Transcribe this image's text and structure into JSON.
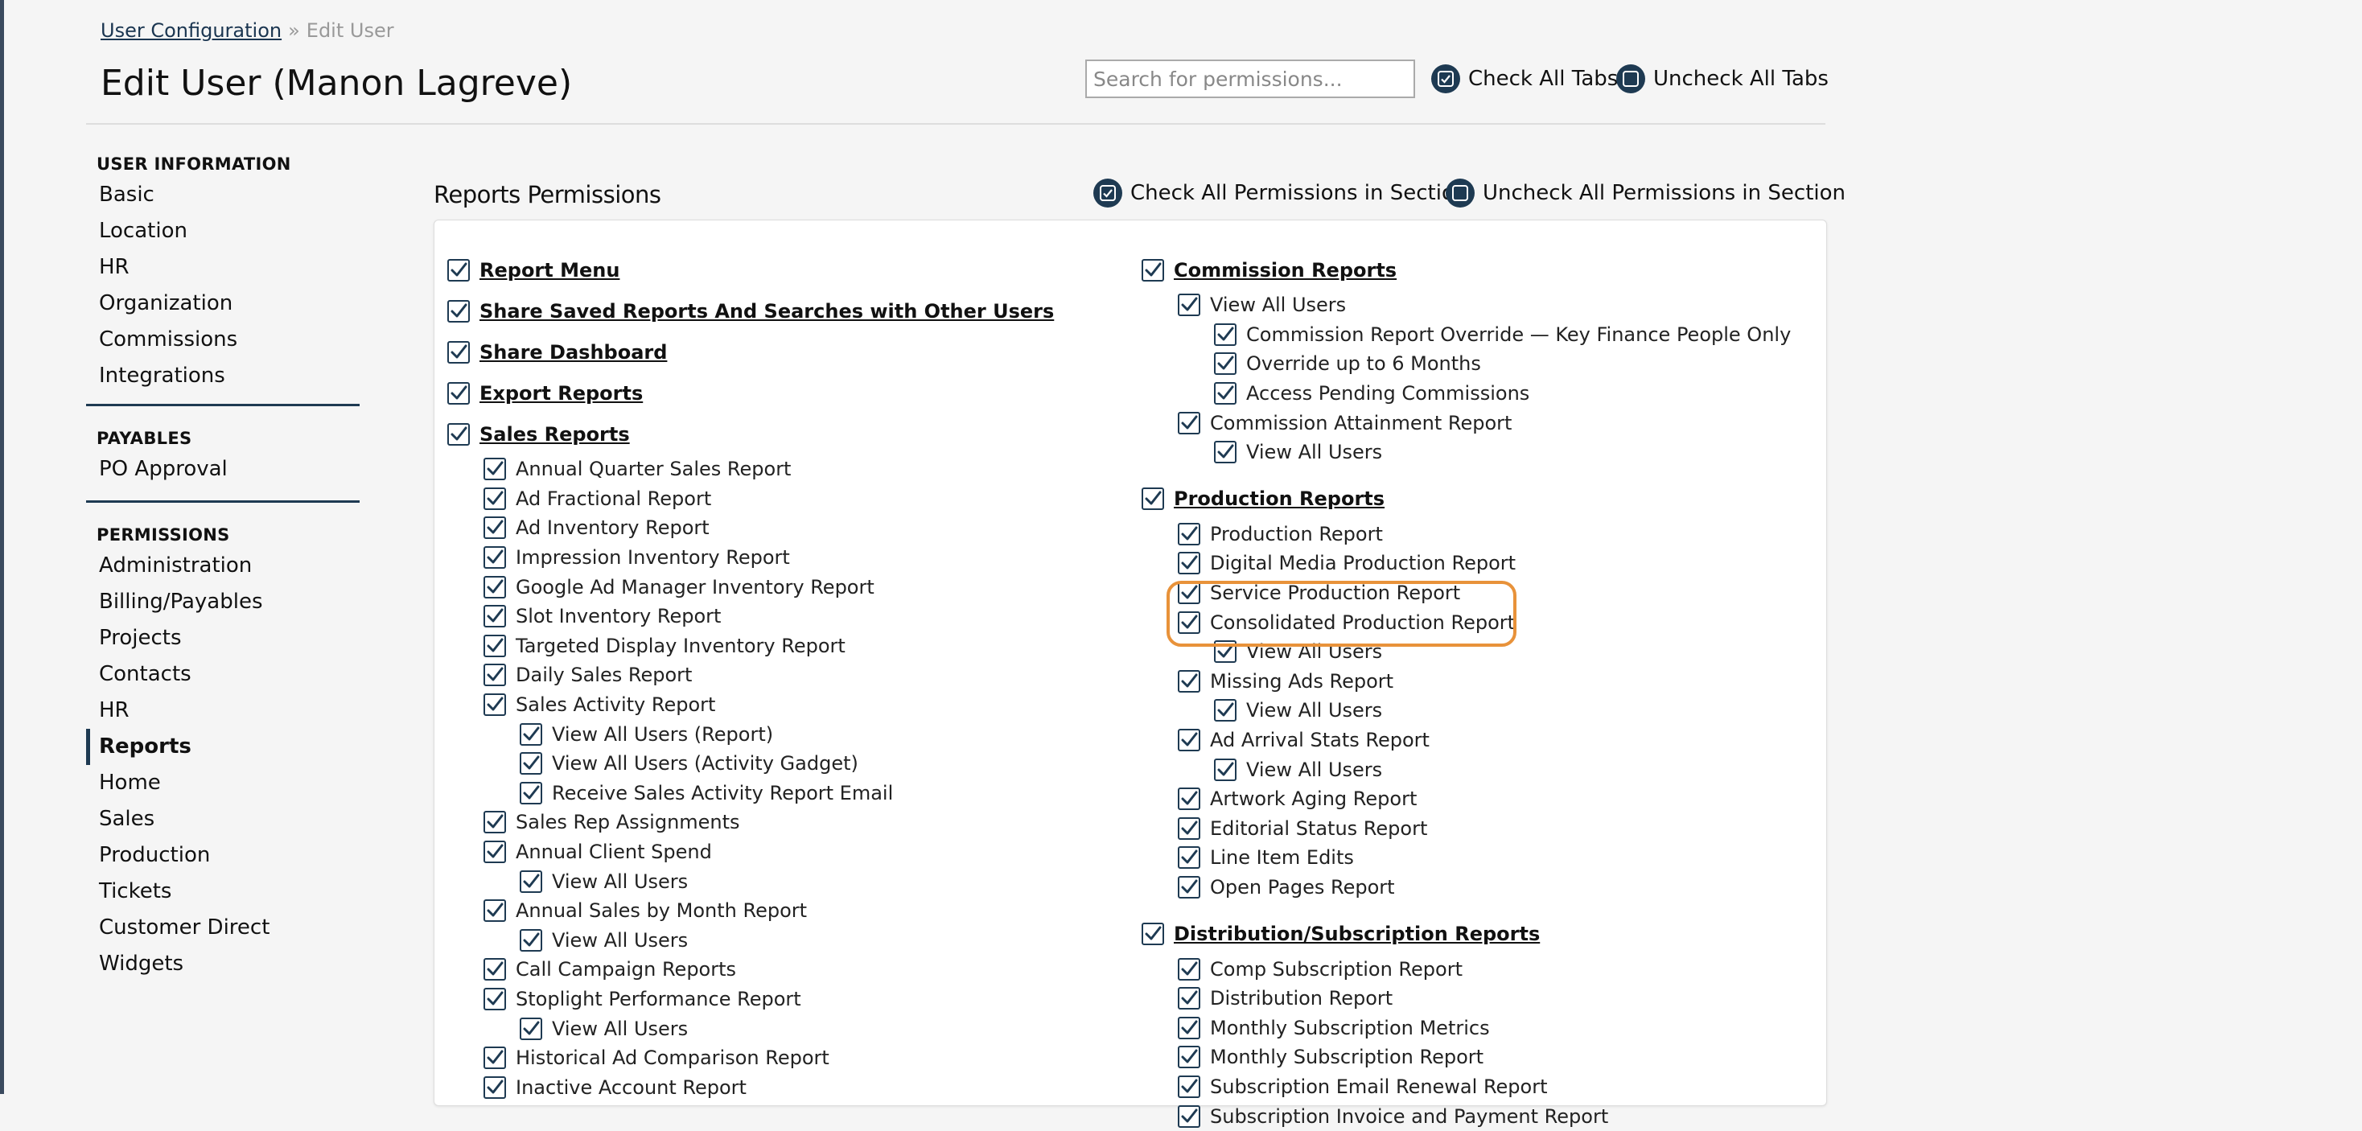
{
  "breadcrumb": {
    "link": "User Configuration",
    "separator": "»",
    "current": "Edit User"
  },
  "page_title": "Edit User (Manon Lagreve)",
  "search": {
    "placeholder": "Search for permissions...",
    "value": ""
  },
  "tab_actions": {
    "check_all": "Check All Tabs",
    "uncheck_all": "Uncheck All Tabs"
  },
  "sidebar": {
    "sections": [
      {
        "heading": "USER INFORMATION",
        "items": [
          "Basic",
          "Location",
          "HR",
          "Organization",
          "Commissions",
          "Integrations"
        ]
      },
      {
        "heading": "PAYABLES",
        "items": [
          "PO Approval"
        ]
      },
      {
        "heading": "PERMISSIONS",
        "items": [
          "Administration",
          "Billing/Payables",
          "Projects",
          "Contacts",
          "HR",
          "Reports",
          "Home",
          "Sales",
          "Production",
          "Tickets",
          "Customer Direct",
          "Widgets"
        ]
      }
    ],
    "active": "Reports"
  },
  "section": {
    "title": "Reports Permissions",
    "check_all": "Check All Permissions in Section",
    "uncheck_all": "Uncheck All Permissions in Section"
  },
  "colors": {
    "accent": "#1e3a52",
    "highlight": "#e8923a"
  },
  "permissions": {
    "left": [
      {
        "label": "Report Menu",
        "level": 0,
        "checked": true
      },
      {
        "label": "Share Saved Reports And Searches with Other Users",
        "level": 0,
        "checked": true
      },
      {
        "label": "Share Dashboard",
        "level": 0,
        "checked": true
      },
      {
        "label": "Export Reports",
        "level": 0,
        "checked": true
      },
      {
        "label": "Sales Reports",
        "level": 0,
        "checked": true
      },
      {
        "label": "Annual Quarter Sales Report",
        "level": 1,
        "checked": true
      },
      {
        "label": "Ad Fractional Report",
        "level": 1,
        "checked": true
      },
      {
        "label": "Ad Inventory Report",
        "level": 1,
        "checked": true
      },
      {
        "label": "Impression Inventory Report",
        "level": 1,
        "checked": true
      },
      {
        "label": "Google Ad Manager Inventory Report",
        "level": 1,
        "checked": true
      },
      {
        "label": "Slot Inventory Report",
        "level": 1,
        "checked": true
      },
      {
        "label": "Targeted Display Inventory Report",
        "level": 1,
        "checked": true
      },
      {
        "label": "Daily Sales Report",
        "level": 1,
        "checked": true
      },
      {
        "label": "Sales Activity Report",
        "level": 1,
        "checked": true
      },
      {
        "label": "View All Users (Report)",
        "level": 2,
        "checked": true
      },
      {
        "label": "View All Users (Activity Gadget)",
        "level": 2,
        "checked": true
      },
      {
        "label": "Receive Sales Activity Report Email",
        "level": 2,
        "checked": true
      },
      {
        "label": "Sales Rep Assignments",
        "level": 1,
        "checked": true
      },
      {
        "label": "Annual Client Spend",
        "level": 1,
        "checked": true
      },
      {
        "label": "View All Users",
        "level": 2,
        "checked": true
      },
      {
        "label": "Annual Sales by Month Report",
        "level": 1,
        "checked": true
      },
      {
        "label": "View All Users",
        "level": 2,
        "checked": true
      },
      {
        "label": "Call Campaign Reports",
        "level": 1,
        "checked": true
      },
      {
        "label": "Stoplight Performance Report",
        "level": 1,
        "checked": true
      },
      {
        "label": "View All Users",
        "level": 2,
        "checked": true
      },
      {
        "label": "Historical Ad Comparison Report",
        "level": 1,
        "checked": true
      },
      {
        "label": "Inactive Account Report",
        "level": 1,
        "checked": true
      }
    ],
    "right": [
      {
        "label": "Commission Reports",
        "level": 0,
        "checked": true
      },
      {
        "label": "View All Users",
        "level": 1,
        "checked": true
      },
      {
        "label": "Commission Report Override — Key Finance People Only",
        "level": 2,
        "checked": true
      },
      {
        "label": "Override up to 6 Months",
        "level": 2,
        "checked": true
      },
      {
        "label": "Access Pending Commissions",
        "level": 2,
        "checked": true
      },
      {
        "label": "Commission Attainment Report",
        "level": 1,
        "checked": true
      },
      {
        "label": "View All Users",
        "level": 2,
        "checked": true
      },
      {
        "label": "Production Reports",
        "level": 0,
        "checked": true
      },
      {
        "label": "Production Report",
        "level": 1,
        "checked": true
      },
      {
        "label": "Digital Media Production Report",
        "level": 1,
        "checked": true
      },
      {
        "label": "Service Production Report",
        "level": 1,
        "checked": true
      },
      {
        "label": "Consolidated Production Report",
        "level": 1,
        "checked": true
      },
      {
        "label": "View All Users",
        "level": 2,
        "checked": true
      },
      {
        "label": "Missing Ads Report",
        "level": 1,
        "checked": true
      },
      {
        "label": "View All Users",
        "level": 2,
        "checked": true
      },
      {
        "label": "Ad Arrival Stats Report",
        "level": 1,
        "checked": true
      },
      {
        "label": "View All Users",
        "level": 2,
        "checked": true
      },
      {
        "label": "Artwork Aging Report",
        "level": 1,
        "checked": true
      },
      {
        "label": "Editorial Status Report",
        "level": 1,
        "checked": true
      },
      {
        "label": "Line Item Edits",
        "level": 1,
        "checked": true
      },
      {
        "label": "Open Pages Report",
        "level": 1,
        "checked": true
      },
      {
        "label": "Distribution/Subscription Reports",
        "level": 0,
        "checked": true
      },
      {
        "label": "Comp Subscription Report",
        "level": 1,
        "checked": true
      },
      {
        "label": "Distribution Report",
        "level": 1,
        "checked": true
      },
      {
        "label": "Monthly Subscription Metrics",
        "level": 1,
        "checked": true
      },
      {
        "label": "Monthly Subscription Report",
        "level": 1,
        "checked": true
      },
      {
        "label": "Subscription Email Renewal Report",
        "level": 1,
        "checked": true
      },
      {
        "label": "Subscription Invoice and Payment Report",
        "level": 1,
        "checked": true
      }
    ]
  }
}
